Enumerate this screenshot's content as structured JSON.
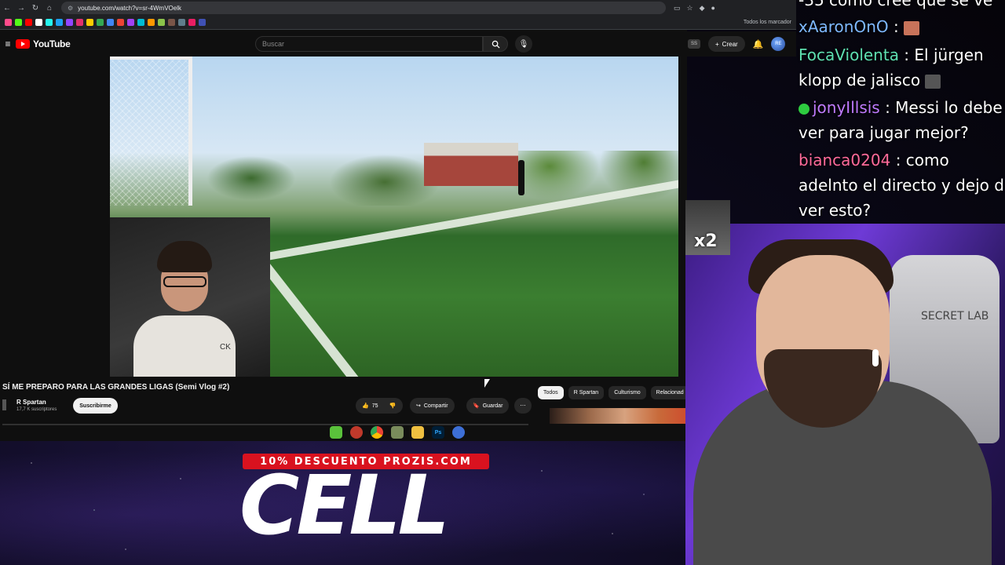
{
  "browser": {
    "url": "youtube.com/watch?v=sr-4WmVOelk",
    "bookmarks_all_label": "Todos los marcador"
  },
  "youtube": {
    "logo_label": "YouTube",
    "search_placeholder": "Buscar",
    "create_label": "Crear",
    "ss_badge": "SS",
    "avatar_label": "RE",
    "video_title": "SÍ ME PREPARO PARA LAS GRANDES LIGAS (Semi Vlog #2)",
    "channel_name": "R Spartan",
    "channel_subs": "17,7 K suscriptores",
    "subscribe_label": "Suscribirme",
    "like_count": "75",
    "share_label": "Compartir",
    "save_label": "Guardar",
    "chips": [
      "Todos",
      "R Spartan",
      "Culturismo",
      "Relacionad"
    ],
    "facecam_logo": "CK"
  },
  "sponsor": {
    "promo_text": "10% DESCUENTO PROZIS.COM",
    "code": "CELL"
  },
  "chat": {
    "messages": [
      {
        "user": "",
        "user_color": "#ffffff",
        "text": "-35 como cree que se ve"
      },
      {
        "user": "xAaronOnO",
        "user_color": "#7eb8ff",
        "text": " : "
      },
      {
        "user": "FocaViolenta",
        "user_color": "#5ee0b0",
        "text": " : El jürgen"
      },
      {
        "user": "",
        "user_color": "#ffffff",
        "text": "klopp de jalisco"
      },
      {
        "user": "jonyIllsis",
        "user_color": "#c07bff",
        "text": " : Messi lo debe"
      },
      {
        "user": "",
        "user_color": "#ffffff",
        "text": "ver para jugar mejor?"
      },
      {
        "user": "bianca0204",
        "user_color": "#ff6a9a",
        "text": " : como"
      },
      {
        "user": "",
        "user_color": "#ffffff",
        "text": "adelnto el directo y dejo de"
      },
      {
        "user": "",
        "user_color": "#ffffff",
        "text": "ver esto?"
      }
    ]
  },
  "overlay": {
    "multiplier": "x2",
    "chair_brand": "SECRET LAB"
  }
}
